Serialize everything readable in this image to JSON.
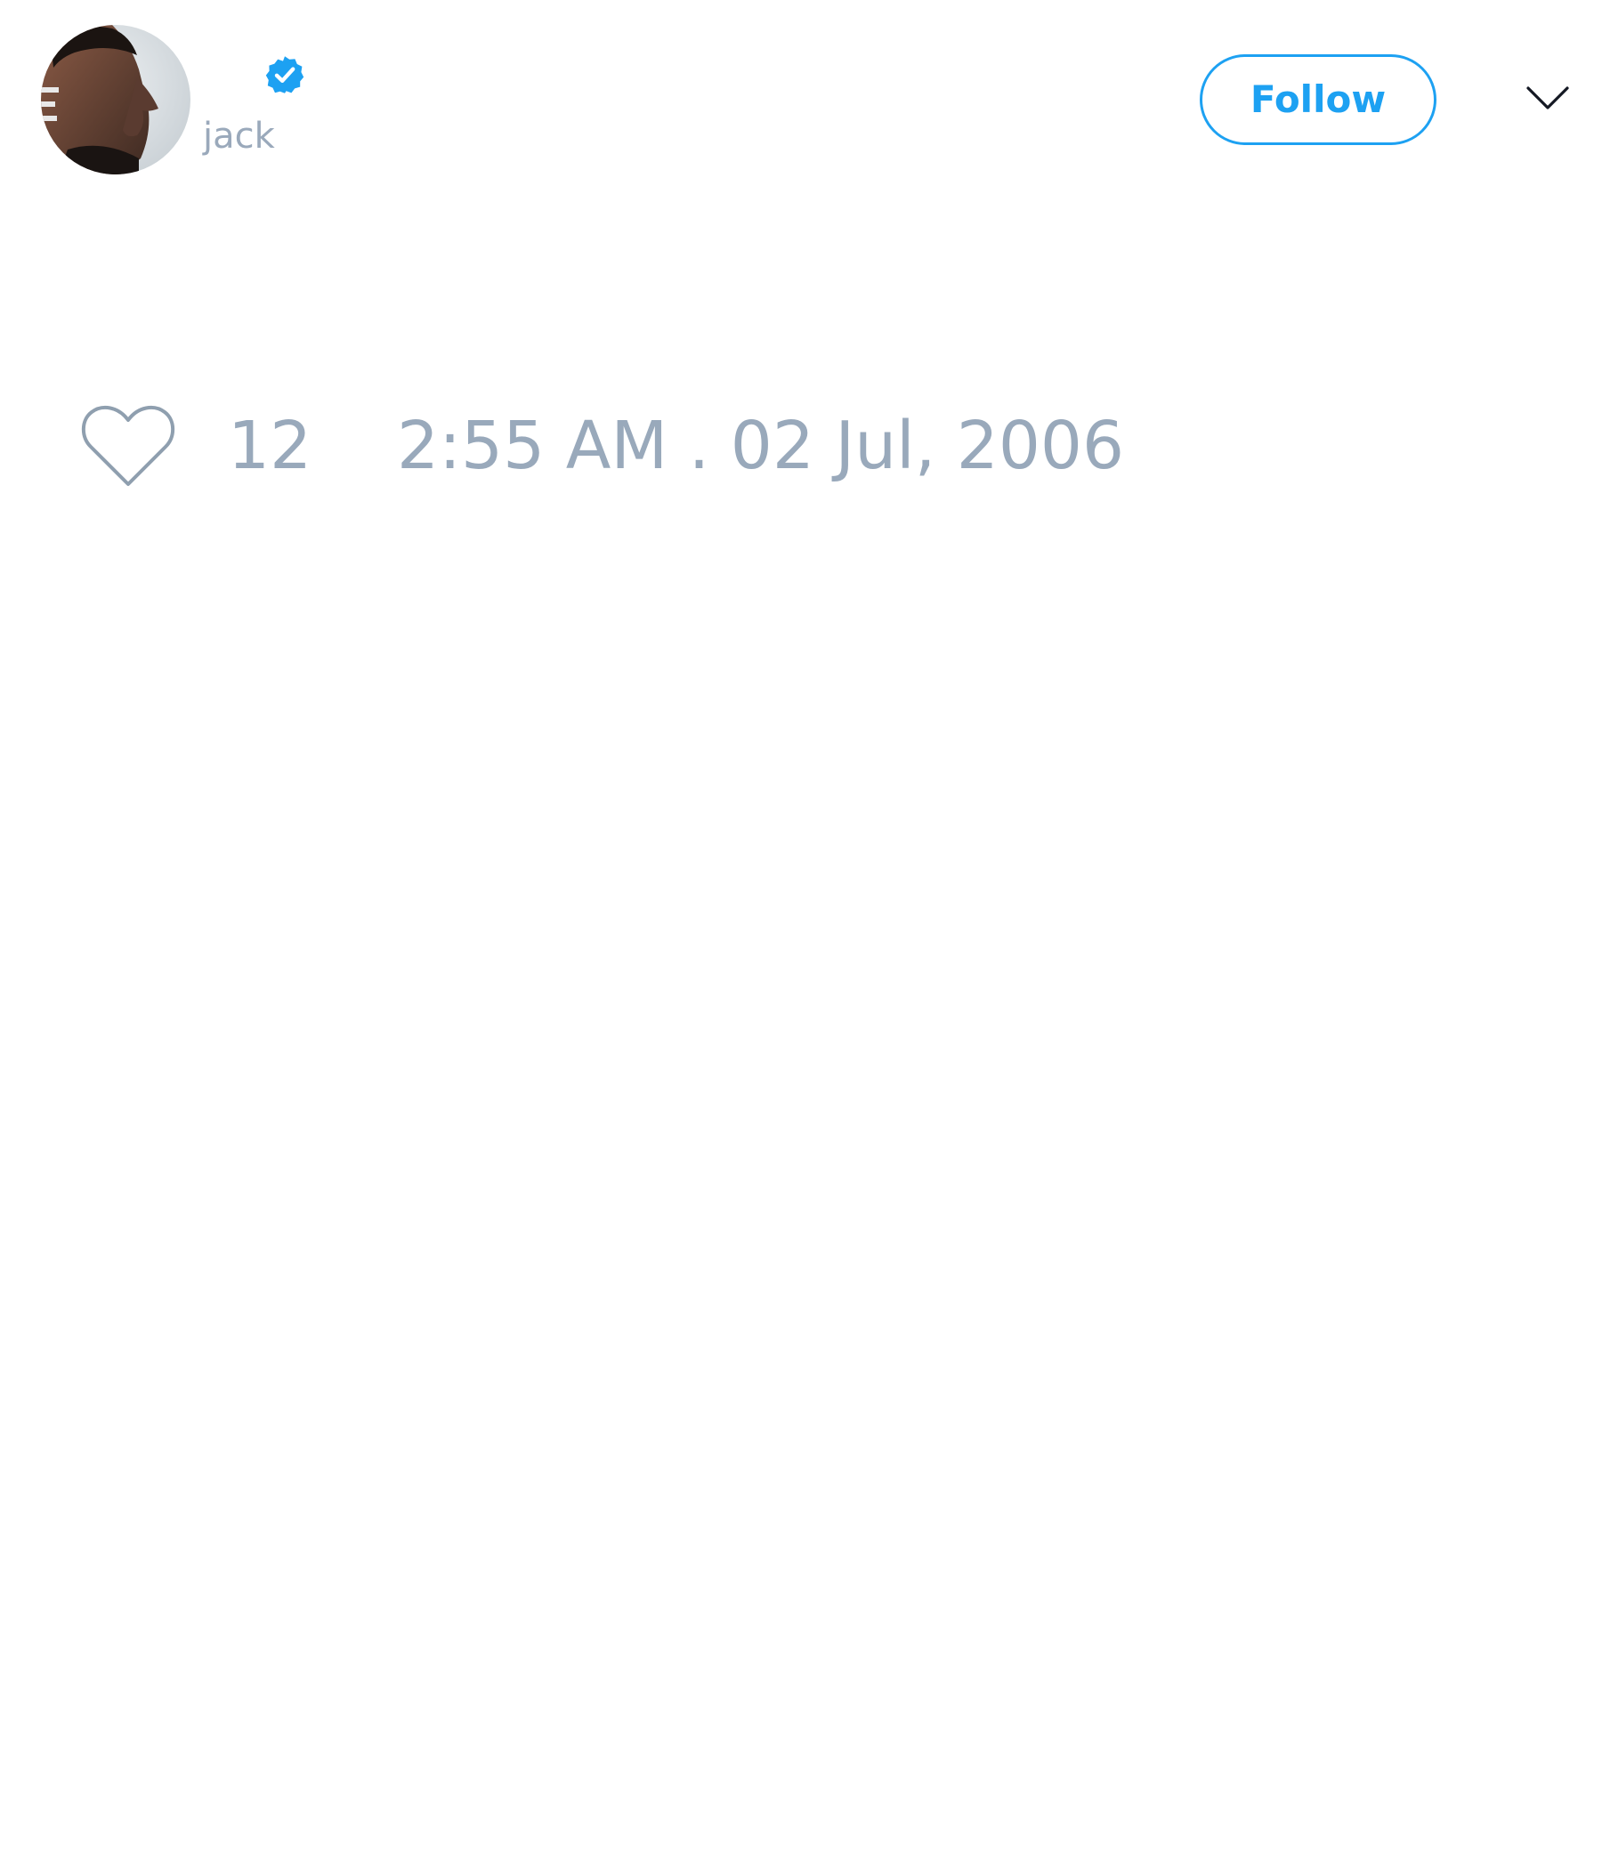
{
  "tweet": {
    "author": {
      "username": "jack",
      "avatar": "profile-photo",
      "verified_icon": "verified-badge-icon"
    },
    "follow_button": {
      "label": "Follow"
    },
    "menu_icon": "chevron-down-icon",
    "like_icon": "heart-outline-icon",
    "like_count": "12",
    "timestamp": "2:55 AM . 02 Jul, 2006"
  },
  "colors": {
    "accent": "#1da1f2",
    "muted_text": "#99a9bb",
    "background": "#ffffff"
  }
}
